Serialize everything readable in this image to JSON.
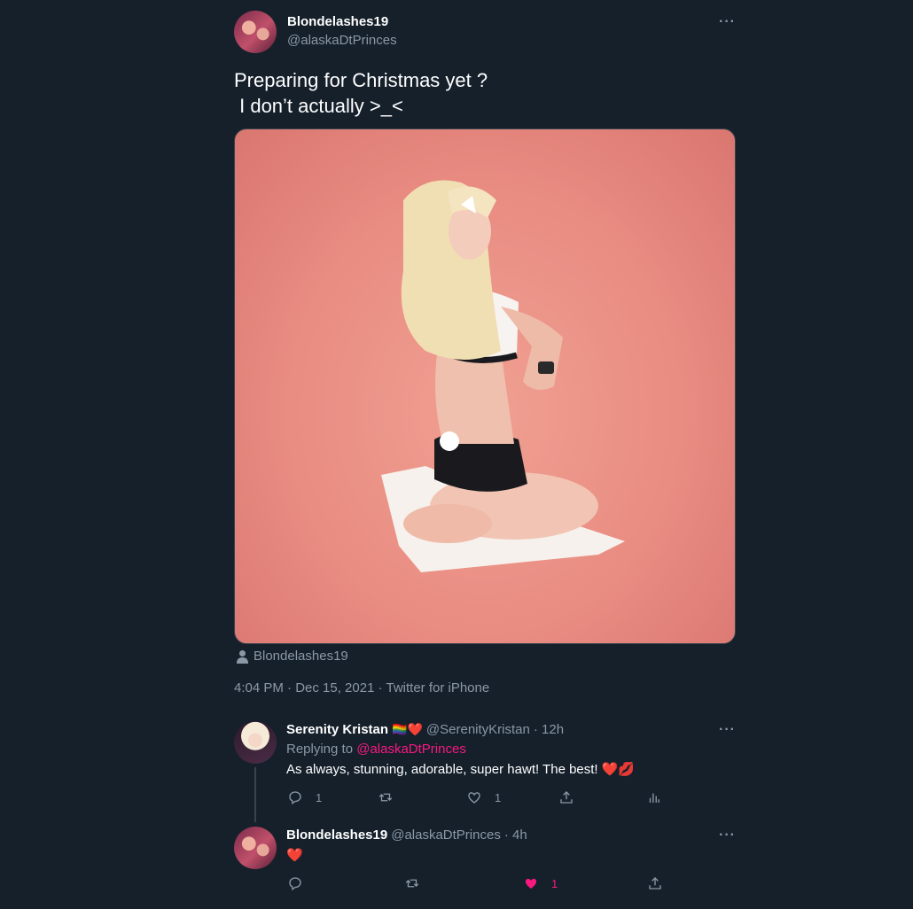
{
  "main_tweet": {
    "display_name": "Blondelashes19",
    "handle": "@alaskaDtPrinces",
    "text": "Preparing for Christmas yet ?\n I don’t actually >_<",
    "tagged_user": "Blondelashes19",
    "timestamp": "4:04 PM · Dec 15, 2021 · Twitter for iPhone",
    "more_label": "···"
  },
  "replies": [
    {
      "display_name": "Serenity Kristan",
      "name_emoji": "🏳️‍🌈❤️",
      "handle": "@SerenityKristan",
      "time": "· 12h",
      "replying_to_label": "Replying to",
      "replying_to_handle": "@alaskaDtPrinces",
      "text": "As always, stunning, adorable, super hawt! The best! ❤️💋",
      "reply_count": "1",
      "retweet_count": "",
      "like_count": "1",
      "more_label": "···"
    },
    {
      "display_name": "Blondelashes19",
      "handle": "@alaskaDtPrinces",
      "time": "· 4h",
      "text": "❤️",
      "reply_count": "",
      "retweet_count": "",
      "like_count": "1",
      "liked": true,
      "more_label": "···"
    }
  ],
  "colors": {
    "background": "#15202b",
    "secondary_text": "#8b98a5",
    "accent_pink": "#f91880",
    "heart_red": "#e0245e"
  }
}
